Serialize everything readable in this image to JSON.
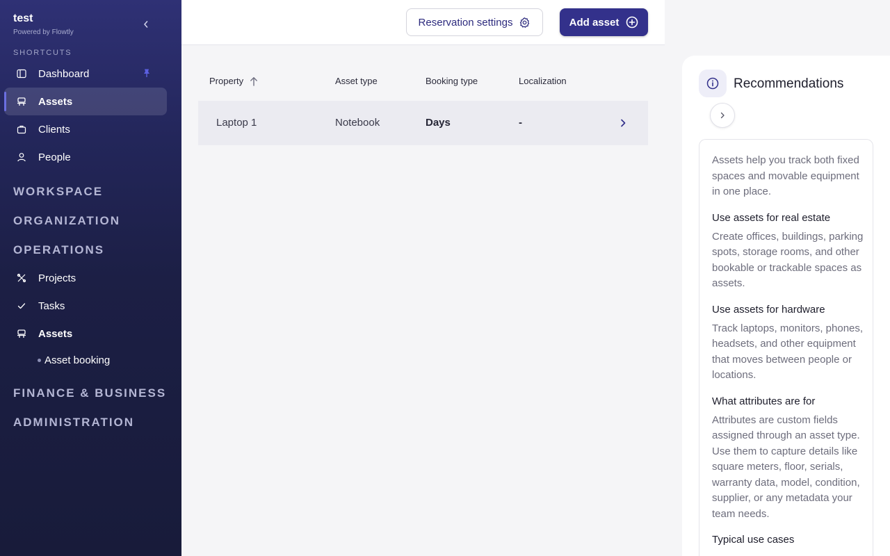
{
  "brand": {
    "name": "test",
    "subtitle": "Powered by Flowtly"
  },
  "sidebar": {
    "shortcuts_label": "SHORTCUTS",
    "shortcuts": [
      {
        "label": "Dashboard",
        "icon": "panel-icon",
        "pinned": true
      },
      {
        "label": "Assets",
        "icon": "asset-icon",
        "active": true
      },
      {
        "label": "Clients",
        "icon": "briefcase-icon"
      },
      {
        "label": "People",
        "icon": "user-icon"
      }
    ],
    "sections": [
      "WORKSPACE",
      "ORGANIZATION",
      "OPERATIONS"
    ],
    "operations_items": [
      {
        "label": "Projects",
        "icon": "projects-icon"
      },
      {
        "label": "Tasks",
        "icon": "check-icon"
      },
      {
        "label": "Assets",
        "icon": "asset-icon"
      }
    ],
    "operations_subitems": [
      {
        "label": "Asset booking"
      }
    ],
    "sections_bottom": [
      "FINANCE & BUSINESS",
      "ADMINISTRATION"
    ]
  },
  "toolbar": {
    "reservation_settings_label": "Reservation settings",
    "add_asset_label": "Add asset"
  },
  "table": {
    "columns": [
      "Property",
      "Asset type",
      "Booking type",
      "Localization"
    ],
    "sort": {
      "column": "Property",
      "direction": "ascending"
    },
    "rows": [
      {
        "property": "Laptop 1",
        "asset_type": "Notebook",
        "booking_type": "Days",
        "localization": "-"
      }
    ]
  },
  "recommendations": {
    "title": "Recommendations",
    "intro": "Assets help you track both fixed spaces and movable equipment in one place.",
    "items": [
      {
        "heading": "Use assets for real estate",
        "text": "Create offices, buildings, parking spots, storage rooms, and other bookable or trackable spaces as assets."
      },
      {
        "heading": "Use assets for hardware",
        "text": "Track laptops, monitors, phones, headsets, and other equipment that moves between people or locations."
      },
      {
        "heading": "What attributes are for",
        "text": "Attributes are custom fields assigned through an asset type. Use them to capture details like square meters, floor, serials, warranty data, model, condition, supplier, or any metadata your team needs."
      },
      {
        "heading": "Typical use cases",
        "text": ""
      }
    ]
  },
  "colors": {
    "sidebar_top": "#2f3175",
    "sidebar_bottom": "#181b3a",
    "primary": "#33318b",
    "pin": "#5b5fe0"
  }
}
